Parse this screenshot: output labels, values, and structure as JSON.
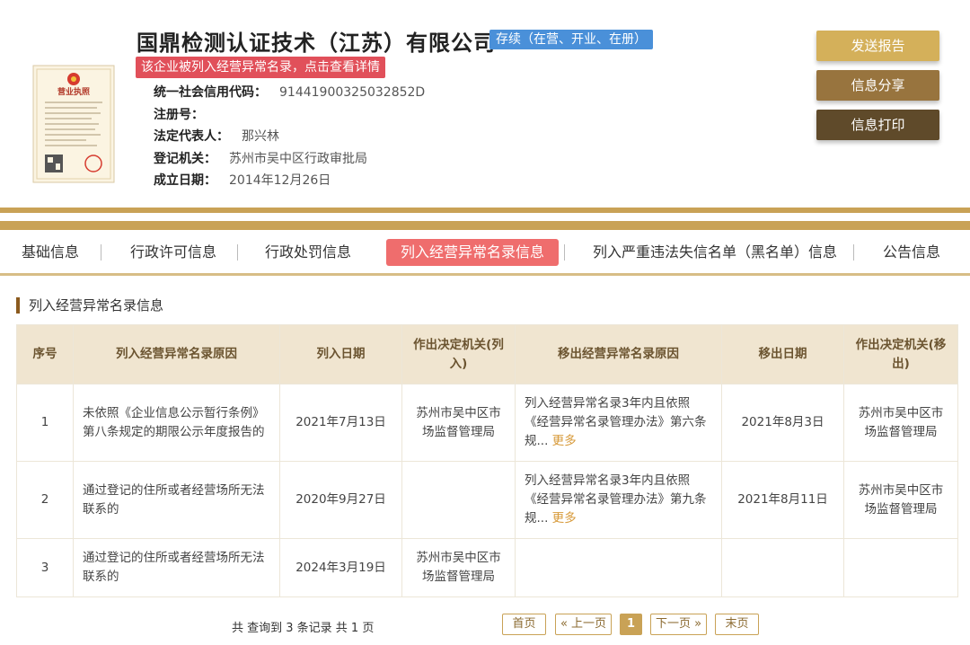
{
  "company": {
    "name": "国鼎检测认证技术（江苏）有限公司",
    "status": "存续（在营、开业、在册）",
    "warning": "该企业被列入经营异常名录，点击查看详情",
    "license_title": "营业执照"
  },
  "info": [
    {
      "label": "统一社会信用代码：",
      "value": "91441900325032852D"
    },
    {
      "label": "注册号：",
      "value": ""
    },
    {
      "label": "法定代表人：",
      "value": "那兴林"
    },
    {
      "label": "登记机关：",
      "value": "苏州市吴中区行政审批局"
    },
    {
      "label": "成立日期：",
      "value": "2014年12月26日"
    }
  ],
  "actions": {
    "send_report": "发送报告",
    "share": "信息分享",
    "print": "信息打印"
  },
  "tabs": [
    {
      "label": "基础信息"
    },
    {
      "label": "行政许可信息"
    },
    {
      "label": "行政处罚信息"
    },
    {
      "label": "列入经营异常名录信息",
      "active": true
    },
    {
      "label": "列入严重违法失信名单（黑名单）信息"
    },
    {
      "label": "公告信息"
    }
  ],
  "section": {
    "title": "列入经营异常名录信息"
  },
  "table": {
    "headers": [
      "序号",
      "列入经营异常名录原因",
      "列入日期",
      "作出决定机关(列入)",
      "移出经营异常名录原因",
      "移出日期",
      "作出决定机关(移出)"
    ],
    "rows": [
      {
        "no": "1",
        "reason": "未依照《企业信息公示暂行条例》第八条规定的期限公示年度报告的",
        "date_in": "2021年7月13日",
        "authority_in": "苏州市吴中区市场监督管理局",
        "remove_reason": "列入经营异常名录3年内且依照《经营异常名录管理办法》第六条规...",
        "more": "更多",
        "date_out": "2021年8月3日",
        "authority_out": "苏州市吴中区市场监督管理局"
      },
      {
        "no": "2",
        "reason": "通过登记的住所或者经营场所无法联系的",
        "date_in": "2020年9月27日",
        "authority_in": "",
        "remove_reason": "列入经营异常名录3年内且依照《经营异常名录管理办法》第九条规...",
        "more": "更多",
        "date_out": "2021年8月11日",
        "authority_out": "苏州市吴中区市场监督管理局"
      },
      {
        "no": "3",
        "reason": "通过登记的住所或者经营场所无法联系的",
        "date_in": "2024年3月19日",
        "authority_in": "苏州市吴中区市场监督管理局",
        "remove_reason": "",
        "more": "",
        "date_out": "",
        "authority_out": ""
      }
    ]
  },
  "pagination": {
    "summary": "共 查询到 3 条记录 共 1 页",
    "first": "首页",
    "prev": "« 上一页",
    "current": "1",
    "next": "下一页 »",
    "last": "末页"
  },
  "colors": {
    "gold": "#c9a256",
    "status_blue": "#4a90d9",
    "warning_red": "#e1505a",
    "active_tab": "#ef6d6d",
    "header_bg": "#f0e5d0",
    "more_link": "#d79a3a"
  }
}
